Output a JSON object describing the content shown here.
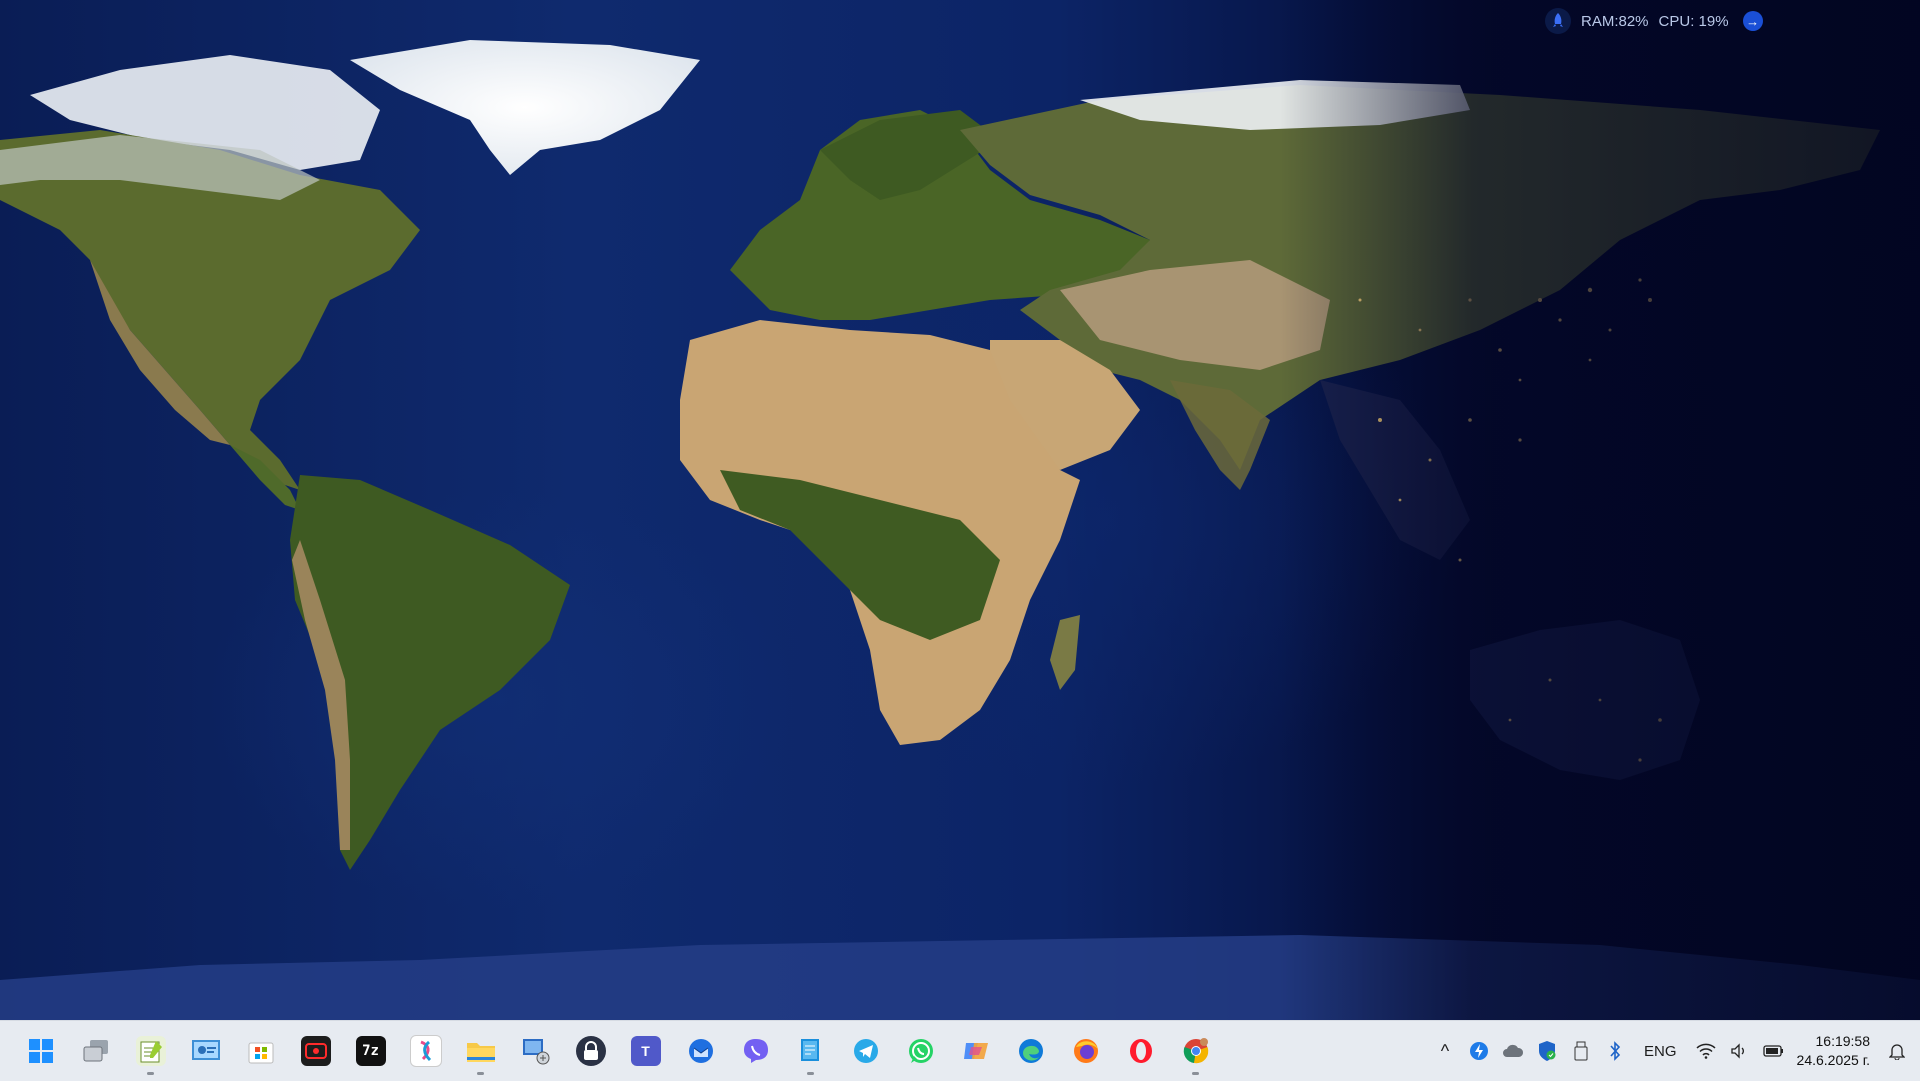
{
  "widget": {
    "ram_label": "RAM:82%",
    "cpu_label": "CPU: 19%",
    "arrow_glyph": "→",
    "rocket_icon": "rocket-icon"
  },
  "taskbar": {
    "apps": [
      {
        "name": "start-button",
        "icon": "windows-logo-icon",
        "running": false
      },
      {
        "name": "task-view-button",
        "icon": "task-view-icon",
        "running": false
      },
      {
        "name": "app-notepad-plus",
        "icon": "notepad-icon",
        "running": true
      },
      {
        "name": "app-control-panel",
        "icon": "control-panel-icon",
        "running": false
      },
      {
        "name": "app-microsoft-store",
        "icon": "store-icon",
        "running": false
      },
      {
        "name": "app-screen-recorder",
        "icon": "recorder-icon",
        "running": false
      },
      {
        "name": "app-7zip",
        "icon": "7zip-icon",
        "label": "7z",
        "running": false
      },
      {
        "name": "app-snipping",
        "icon": "snip-icon",
        "running": false
      },
      {
        "name": "app-file-explorer",
        "icon": "folder-icon",
        "running": true
      },
      {
        "name": "app-remote-desktop",
        "icon": "remote-desktop-icon",
        "running": false
      },
      {
        "name": "app-vpn",
        "icon": "lock-icon",
        "running": false
      },
      {
        "name": "app-teams",
        "icon": "teams-icon",
        "label": "T",
        "running": false
      },
      {
        "name": "app-thunderbird",
        "icon": "thunderbird-icon",
        "running": false
      },
      {
        "name": "app-viber",
        "icon": "viber-icon",
        "running": false
      },
      {
        "name": "app-document",
        "icon": "document-icon",
        "running": true
      },
      {
        "name": "app-telegram",
        "icon": "telegram-icon",
        "running": false
      },
      {
        "name": "app-whatsapp",
        "icon": "whatsapp-icon",
        "running": false
      },
      {
        "name": "app-copilot",
        "icon": "copilot-icon",
        "running": false
      },
      {
        "name": "app-edge",
        "icon": "edge-icon",
        "running": false
      },
      {
        "name": "app-firefox",
        "icon": "firefox-icon",
        "running": false
      },
      {
        "name": "app-opera",
        "icon": "opera-icon",
        "running": false
      },
      {
        "name": "app-chrome",
        "icon": "chrome-icon",
        "running": true
      }
    ],
    "tray": {
      "chevron": "^",
      "lang": "ENG",
      "time": "16:19:58",
      "date": "24.6.2025 г."
    }
  },
  "colors": {
    "taskbar_bg": "#e7ebf1",
    "accent": "#1a4fd6"
  }
}
